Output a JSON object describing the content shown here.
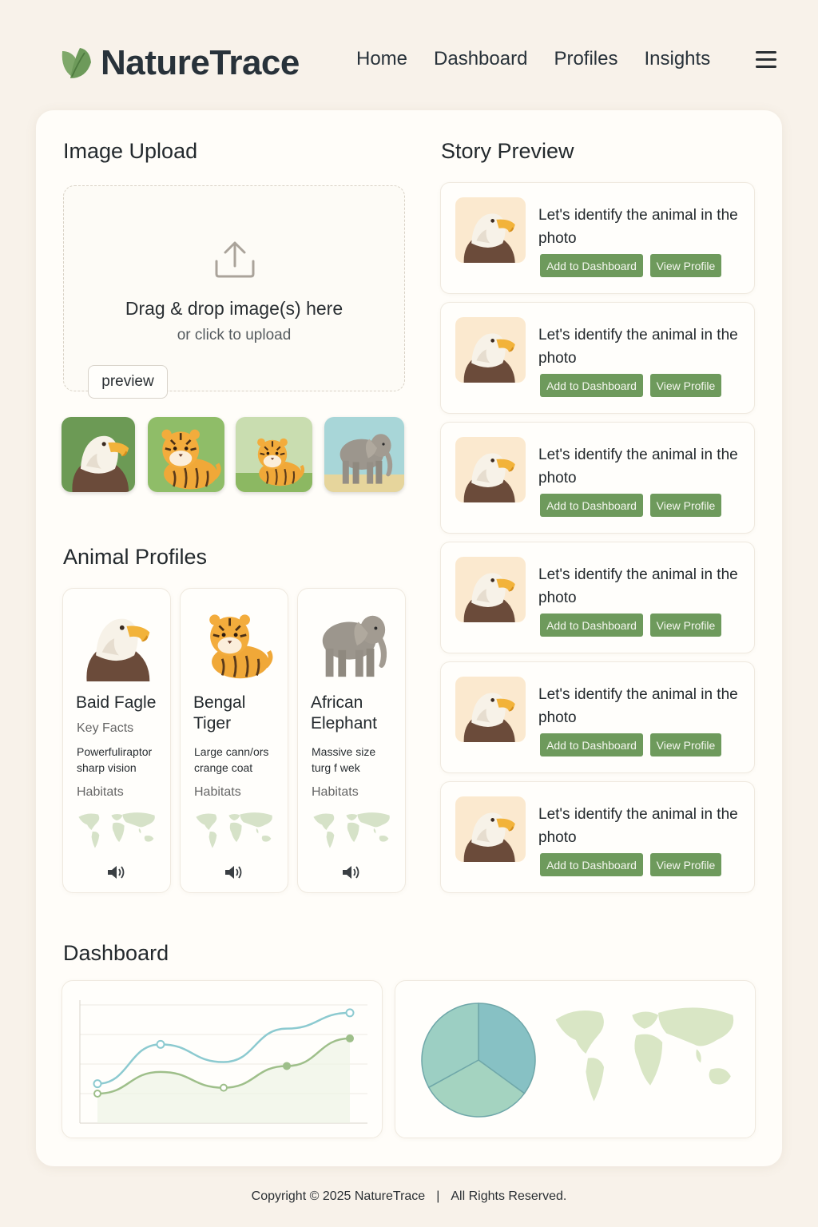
{
  "app": {
    "name": "NatureTrace",
    "logo_icon": "leaf-icon",
    "accent_color": "#6e9a5c"
  },
  "nav": {
    "items": [
      "Home",
      "Dashboard",
      "Profiles",
      "Insights"
    ],
    "menu_icon": "hamburger-menu-icon"
  },
  "upload": {
    "title": "Image Upload",
    "drop_main": "Drag & drop image(s) here",
    "drop_sub": "or click to upload",
    "preview_label": "preview",
    "thumbnails": [
      "eagle",
      "tiger",
      "tiger-in-grass",
      "elephant"
    ]
  },
  "profiles": {
    "title": "Animal Profiles",
    "items": [
      {
        "name": "Baid Fagle",
        "facts_label": "Key Facts",
        "fact1": "Powerfuliraptor",
        "fact2": "sharp vision",
        "habitats_label": "Habitats"
      },
      {
        "name": "Bengal Tiger",
        "fact1": "Large cann/ors",
        "fact2": "crange coat",
        "habitats_label": "Habitats"
      },
      {
        "name": "African Elephant",
        "fact1": "Massive size",
        "fact2": "turg f wek",
        "habitats_label": "Habitats"
      }
    ]
  },
  "story": {
    "title": "Story Preview",
    "cards": [
      {
        "text": "Let's identify the animal in the photo",
        "add_label": "Add to Dashboard",
        "view_label": "View Profile"
      },
      {
        "text": "Let's identify the animal in the photo",
        "add_label": "Add to Dashboard",
        "view_label": "View Profile"
      },
      {
        "text": "Let's identify the animal in the photo",
        "add_label": "Add to Dashboard",
        "view_label": "View Profile"
      },
      {
        "text": "Let's identify the animal in the photo",
        "add_label": "Add to Dashboard",
        "view_label": "View Profile"
      },
      {
        "text": "Let's identify the animal in the photo",
        "add_label": "Add to Dashboard",
        "view_label": "View Profile"
      },
      {
        "text": "Let's identify the animal in the photo",
        "add_label": "Add to Dashboard",
        "view_label": "View Profile"
      }
    ]
  },
  "dashboard": {
    "title": "Dashboard"
  },
  "chart_data": [
    {
      "type": "line",
      "series": [
        {
          "values": [
            2.0,
            4.0,
            3.1,
            4.8,
            5.6
          ],
          "color": "#8ccad0"
        },
        {
          "values": [
            1.5,
            2.6,
            1.8,
            2.9,
            4.3
          ],
          "color": "#9ebf8a"
        }
      ],
      "x": [
        1,
        2,
        3,
        4,
        5
      ],
      "grid": true
    },
    {
      "type": "pie",
      "values": [
        35,
        32,
        33
      ],
      "colors": [
        "#87c1c4",
        "#a4d3c0",
        "#9ccfc3"
      ]
    }
  ],
  "footer": {
    "copyright": "Copyright © 2025 NatureTrace",
    "separator": "|",
    "rights": "All Rights Reserved."
  }
}
